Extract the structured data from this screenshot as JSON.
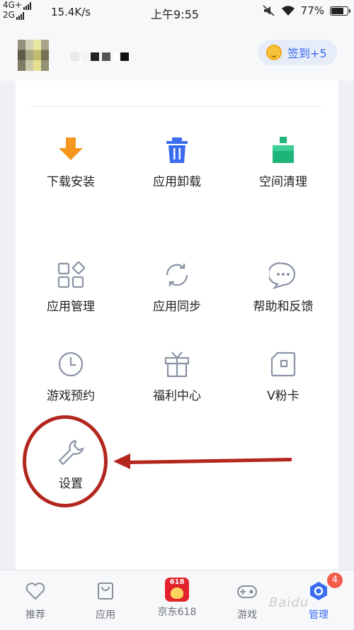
{
  "status_bar": {
    "network_top": "4G+",
    "network_bottom": "2G",
    "speed": "15.4K/s",
    "time": "上午9:55",
    "battery": "77%",
    "battery_level": 0.77
  },
  "header": {
    "signin_label": "签到+5"
  },
  "menu": {
    "items": [
      {
        "label": "下载安装",
        "icon": "download-icon"
      },
      {
        "label": "应用卸载",
        "icon": "trash-icon"
      },
      {
        "label": "空间清理",
        "icon": "broom-icon"
      },
      {
        "label": "应用管理",
        "icon": "app-grid-icon"
      },
      {
        "label": "应用同步",
        "icon": "sync-icon"
      },
      {
        "label": "帮助和反馈",
        "icon": "chat-bubble-icon"
      },
      {
        "label": "游戏预约",
        "icon": "clock-icon"
      },
      {
        "label": "福利中心",
        "icon": "gift-icon"
      },
      {
        "label": "V粉卡",
        "icon": "card-icon"
      },
      {
        "label": "设置",
        "icon": "wrench-icon"
      }
    ]
  },
  "bottom_nav": {
    "items": [
      {
        "label": "推荐",
        "icon": "heart-icon"
      },
      {
        "label": "应用",
        "icon": "bag-icon"
      },
      {
        "label": "京东618",
        "icon": "jd618-icon",
        "icon_text": "618"
      },
      {
        "label": "游戏",
        "icon": "gamepad-icon"
      },
      {
        "label": "管理",
        "icon": "manage-icon"
      }
    ],
    "badge_count": "4"
  },
  "watermark": "Baidu",
  "colors": {
    "accent_blue": "#3a6cf0",
    "download_orange": "#f5961e",
    "broom_green": "#1fb47a",
    "annotation_red": "#b3261e",
    "icon_gray": "#8a93a6"
  }
}
